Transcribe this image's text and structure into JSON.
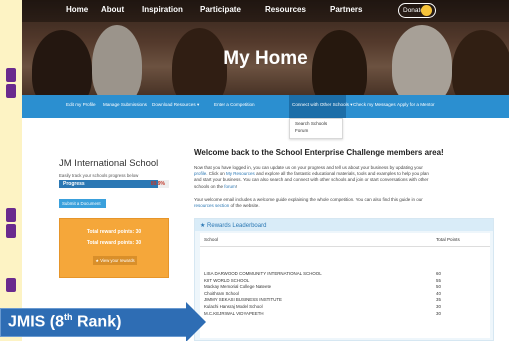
{
  "topnav": {
    "items": [
      "Home",
      "About",
      "Inspiration",
      "Participate",
      "Resources",
      "Partners"
    ],
    "donate_label": "Donate"
  },
  "hero": {
    "title": "My Home"
  },
  "subnav": {
    "items": [
      "Edit my Profile",
      "Manage Submissions",
      "Download Resources ▾",
      "Enter a Competition",
      "Connect with Other Schools ▾",
      "Check my Messages",
      "Apply for a Mentor"
    ],
    "active_index": 4,
    "dropdown": [
      "Search Schools",
      "Forum"
    ]
  },
  "school": {
    "name": "JM International School",
    "tracker_note": "Easily track your schools progress below",
    "progress_label": "Progress",
    "progress_text": "89.9%",
    "progress_value": 0.899,
    "submit_label": "Submit a Document",
    "reward_line_1": "Total reward points: 30",
    "reward_line_2": "Total reward points: 30",
    "view_rewards_label": "★ View your rewards"
  },
  "welcome": {
    "heading": "Welcome back to the School Enterprise Challenge members area!",
    "p1a": "Now that you have logged in, you can update us on your progress and tell us about your business by updating your",
    "p1b": "profile",
    "p1c": ". Click on",
    "p1d": "My Resources",
    "p1e": "and explore all the fantastic educational materials, tools and examples to help you plan",
    "p1f": "and start your business. You can also search and connect with other schools and join or start conversations with other",
    "p1g": "schools on the",
    "p1h": "forum",
    "p1i": "!",
    "p2a": "Your welcome email includes a welcome guide explaining the whole competition. You can also find this guide in our",
    "p2b": "resources section",
    "p2c": "of the website."
  },
  "leaderboard": {
    "title": "★ Rewards Leaderboard",
    "columns": [
      "School",
      "Total Points"
    ],
    "rows": [
      {
        "school": "LISA DARWOOD COMMUNITY INTERNATIONAL SCHOOL",
        "points": "60"
      },
      {
        "school": "KIIT WORLD SCHOOL",
        "points": "55"
      },
      {
        "school": "Mackay Memorial College Nateete",
        "points": "50"
      },
      {
        "school": "Choithram School",
        "points": "40"
      },
      {
        "school": "JIMMY SEKASI BUSINESS INSTITUTE",
        "points": "35"
      },
      {
        "school": "Kulachi Hansraj Model School",
        "points": "30"
      },
      {
        "school": "M.C.KEJRIWAL VIDYAPEETH",
        "points": "30"
      }
    ]
  },
  "caption": {
    "text_main": "JMIS (8",
    "text_sup": "th",
    "text_end": " Rank)"
  },
  "colors": {
    "accent": "#2b8fd0",
    "reward": "#f5a73a",
    "caption": "#2e6db4",
    "frame": "#fdf3c4"
  }
}
